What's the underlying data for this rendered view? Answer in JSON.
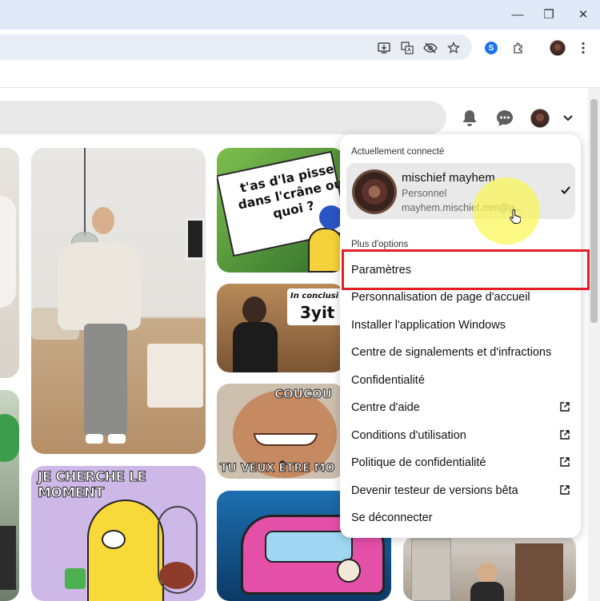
{
  "browser": {
    "window_controls": {
      "minimize": "—",
      "restore": "❐",
      "close": "✕"
    },
    "toolbar_icons": [
      "install-app-icon",
      "translate-icon",
      "eye-off-icon",
      "star-icon",
      "shazam-icon",
      "extensions-icon",
      "profile-avatar",
      "more-menu-icon"
    ]
  },
  "pinterest_header": {
    "icons": [
      "bell-icon",
      "chat-icon",
      "avatar",
      "chevron-down-icon"
    ]
  },
  "pins": {
    "pisse_text": "t'as d'la pisse dans l'crâne ou quoi ?",
    "conclusion_text": "In conclusi",
    "yit_text": "3yit",
    "coucou_text": "COUCOU",
    "tu_veux_text": "TU VEUX ÊTRE MO",
    "je_cherche_text": "JE CHERCHE LE MOMENT"
  },
  "menu": {
    "section_current": "Actuellement connecté",
    "account": {
      "name": "mischief mayhem",
      "type": "Personnel",
      "email": "mayhem.mischief.mm@g..."
    },
    "section_more": "Plus d'options",
    "items": [
      {
        "label": "Paramètres",
        "external": false
      },
      {
        "label": "Personnalisation de page d'accueil",
        "external": false
      },
      {
        "label": "Installer l'application Windows",
        "external": false
      },
      {
        "label": "Centre de signalements et d'infractions",
        "external": false
      },
      {
        "label": "Confidentialité",
        "external": false
      },
      {
        "label": "Centre d'aide",
        "external": true
      },
      {
        "label": "Conditions d'utilisation",
        "external": true
      },
      {
        "label": "Politique de confidentialité",
        "external": true
      },
      {
        "label": "Devenir testeur de versions bêta",
        "external": true
      },
      {
        "label": "Se déconnecter",
        "external": false
      }
    ]
  },
  "colors": {
    "highlight_box": "#e41e26",
    "titlebar": "#dfe9f8",
    "account_bg": "#e9e9e9"
  }
}
